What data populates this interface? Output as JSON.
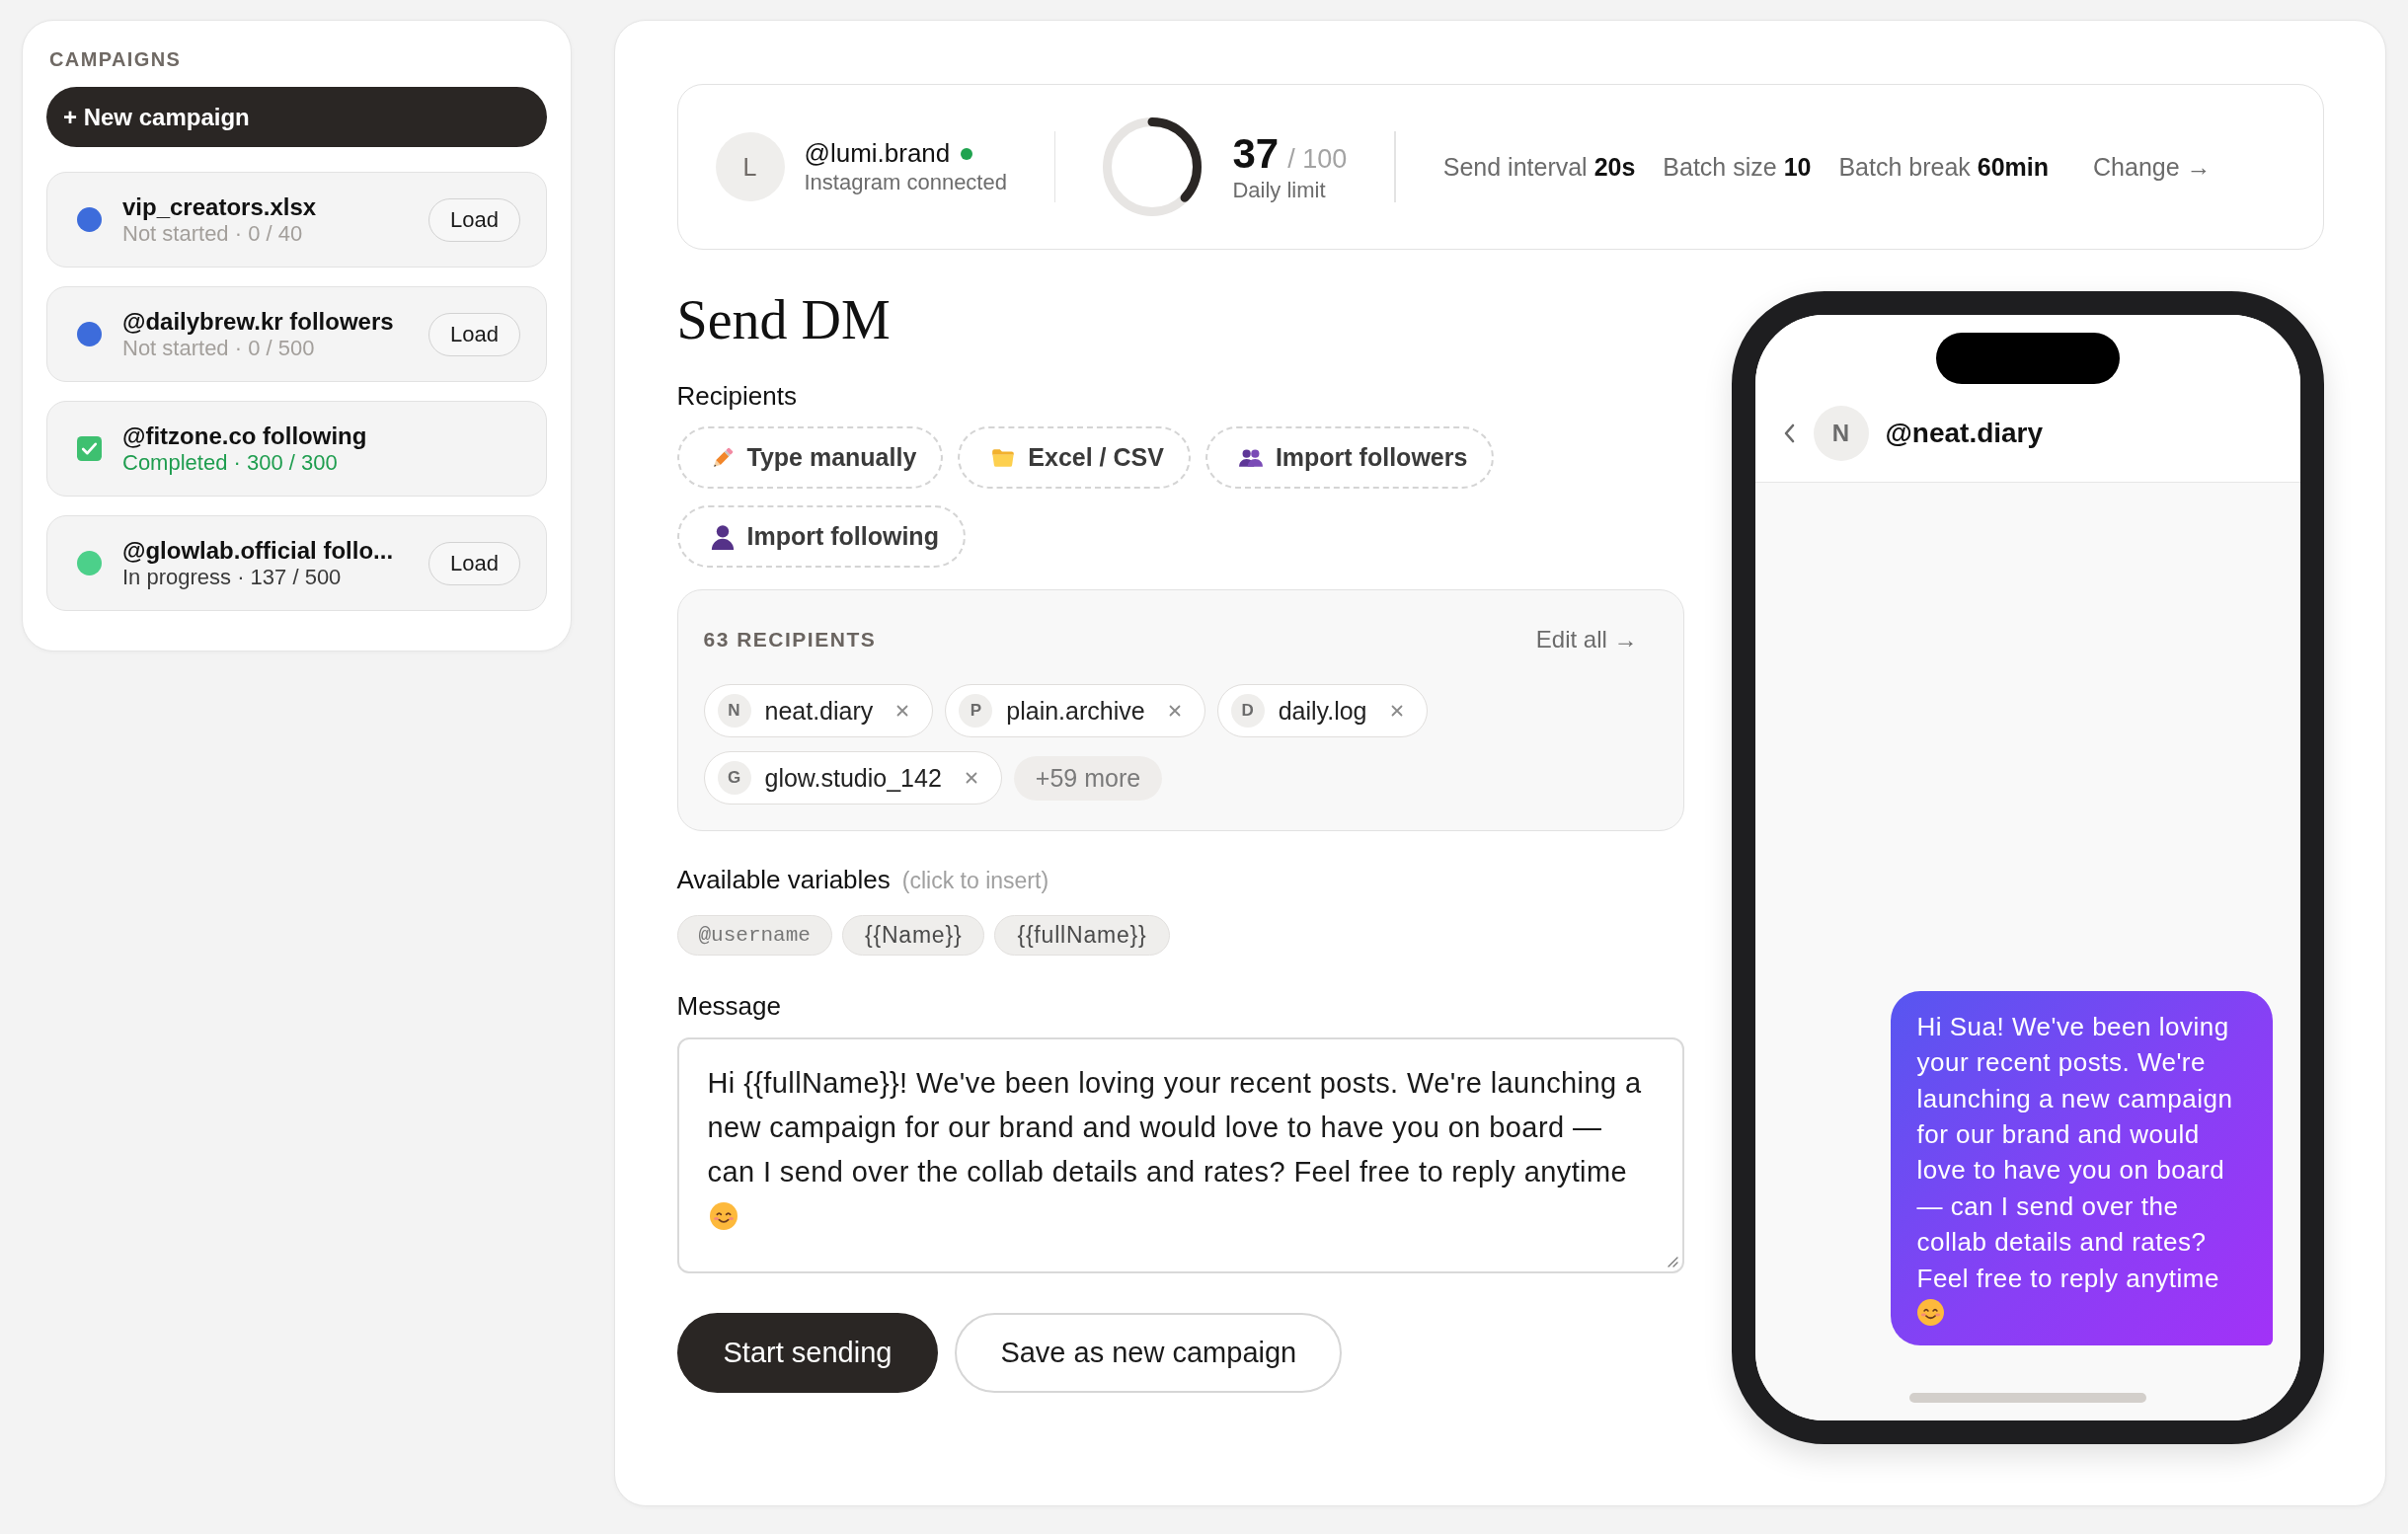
{
  "sidebar": {
    "title": "CAMPAIGNS",
    "new_campaign": "+ New campaign",
    "campaigns": [
      {
        "name": "vip_creators.xlsx",
        "progress": "Not started · 0 / 40",
        "started": false,
        "completed": false,
        "color": "#3d6cdb",
        "action": "Load"
      },
      {
        "name": "@dailybrew.kr followers",
        "progress": "Not started · 0 / 500",
        "started": false,
        "completed": false,
        "color": "#3d6cdb",
        "action": "Load"
      },
      {
        "name": "@fitzone.co following",
        "progress": "Completed · 300 / 300",
        "started": true,
        "completed": true,
        "color": "#3ec070"
      },
      {
        "name": "@glowlab.official follo...",
        "progress": "In progress · 137 / 500",
        "started": true,
        "completed": false,
        "color": "#4cd08a",
        "action": "Load"
      }
    ]
  },
  "account": {
    "initial": "L",
    "handle": "@lumi.brand",
    "online": true,
    "connection": "Instagram connected"
  },
  "daily_limit": {
    "used": "37",
    "total": "/ 100",
    "label": "Daily limit",
    "level": 0.37
  },
  "settings": [
    "Send interval **20s**",
    "Batch size **10**",
    "Batch break **60min**"
  ],
  "change_link": "Change →",
  "send_dm": {
    "title": "Send DM",
    "recipients_label": "Recipients",
    "sources": [
      {
        "label": "Type manually"
      },
      {
        "label": "Excel / CSV"
      },
      {
        "label": "Import followers"
      },
      {
        "label": "Import following"
      }
    ],
    "recipients": {
      "count": "63 RECIPIENTS",
      "edit_link": "Edit all →",
      "chips": [
        {
          "initial": "N",
          "name": "neat.diary"
        },
        {
          "initial": "P",
          "name": "plain.archive"
        },
        {
          "initial": "D",
          "name": "daily.log"
        },
        {
          "initial": "G",
          "name": "glow.studio_142"
        }
      ],
      "more": "+59 more"
    },
    "variables": {
      "label": "Available variables",
      "hint": "(click to insert)",
      "items": [
        {
          "kind": "code",
          "text": "@username"
        },
        {
          "kind": "template",
          "text": "{{Name}}"
        },
        {
          "kind": "template",
          "text": "{{fullName}}"
        }
      ]
    },
    "message": {
      "label": "Message",
      "value": "Hi {{fullName}}! We've been loving your recent posts. We're launching a new campaign for our brand and would love to have you on board — can I send over the collab details and rates? Feel free to reply anytime"
    },
    "actions": [
      {
        "kind": "primary",
        "label": "Start sending"
      },
      {
        "kind": "secondary",
        "label": "Save as new campaign"
      }
    ]
  },
  "preview": {
    "initial": "N",
    "handle": "@neat.diary",
    "message": "Hi Sua! We've been loving your recent posts. We're launching a new campaign for our brand and would love to have you on board — can I send over the collab details and rates? Feel free to reply anytime"
  }
}
